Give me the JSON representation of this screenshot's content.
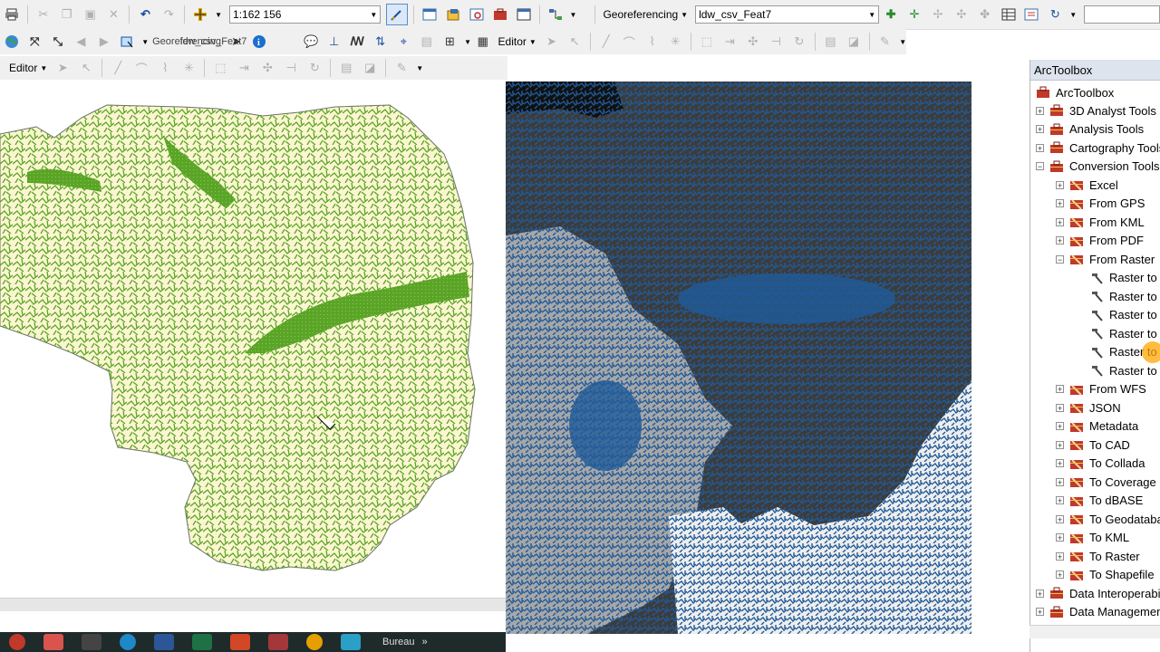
{
  "toolbar1": {
    "scale_value": "1:162 156",
    "georef_label": "Georeferencing",
    "layer_value": "ldw_csv_Feat7"
  },
  "toolbar2": {
    "editor_label": "Editor",
    "ghost_georef": "Georeferencing",
    "ghost_layer": "ldw_csv_Feat7"
  },
  "toolbar3": {
    "editor_label": "Editor"
  },
  "taskbar": {
    "text": "Bureau"
  },
  "toolbox": {
    "title": "ArcToolbox",
    "root": "ArcToolbox",
    "items": [
      {
        "label": "3D Analyst Tools",
        "level": 1,
        "expander": "+",
        "icon": "toolbox-icon"
      },
      {
        "label": "Analysis Tools",
        "level": 1,
        "expander": "+",
        "icon": "toolbox-icon"
      },
      {
        "label": "Cartography Tools",
        "level": 1,
        "expander": "+",
        "icon": "toolbox-icon"
      },
      {
        "label": "Conversion Tools",
        "level": 1,
        "expander": "−",
        "icon": "toolbox-icon"
      },
      {
        "label": "Excel",
        "level": 2,
        "expander": "+",
        "icon": "toolset-icon"
      },
      {
        "label": "From GPS",
        "level": 2,
        "expander": "+",
        "icon": "toolset-icon"
      },
      {
        "label": "From KML",
        "level": 2,
        "expander": "+",
        "icon": "toolset-icon"
      },
      {
        "label": "From PDF",
        "level": 2,
        "expander": "+",
        "icon": "toolset-icon"
      },
      {
        "label": "From Raster",
        "level": 2,
        "expander": "−",
        "icon": "toolset-icon"
      },
      {
        "label": "Raster to",
        "level": 3,
        "expander": "",
        "icon": "hammer-icon"
      },
      {
        "label": "Raster to",
        "level": 3,
        "expander": "",
        "icon": "hammer-icon"
      },
      {
        "label": "Raster to",
        "level": 3,
        "expander": "",
        "icon": "hammer-icon"
      },
      {
        "label": "Raster to",
        "level": 3,
        "expander": "",
        "icon": "hammer-icon"
      },
      {
        "label": "Raster to",
        "level": 3,
        "expander": "",
        "icon": "hammer-icon"
      },
      {
        "label": "Raster to",
        "level": 3,
        "expander": "",
        "icon": "hammer-icon"
      },
      {
        "label": "From WFS",
        "level": 2,
        "expander": "+",
        "icon": "toolset-icon"
      },
      {
        "label": "JSON",
        "level": 2,
        "expander": "+",
        "icon": "toolset-icon"
      },
      {
        "label": "Metadata",
        "level": 2,
        "expander": "+",
        "icon": "toolset-icon"
      },
      {
        "label": "To CAD",
        "level": 2,
        "expander": "+",
        "icon": "toolset-icon"
      },
      {
        "label": "To Collada",
        "level": 2,
        "expander": "+",
        "icon": "toolset-icon"
      },
      {
        "label": "To Coverage",
        "level": 2,
        "expander": "+",
        "icon": "toolset-icon"
      },
      {
        "label": "To dBASE",
        "level": 2,
        "expander": "+",
        "icon": "toolset-icon"
      },
      {
        "label": "To Geodatabase",
        "level": 2,
        "expander": "+",
        "icon": "toolset-icon"
      },
      {
        "label": "To KML",
        "level": 2,
        "expander": "+",
        "icon": "toolset-icon"
      },
      {
        "label": "To Raster",
        "level": 2,
        "expander": "+",
        "icon": "toolset-icon"
      },
      {
        "label": "To Shapefile",
        "level": 2,
        "expander": "+",
        "icon": "toolset-icon"
      },
      {
        "label": "Data Interoperability Tools",
        "level": 1,
        "expander": "+",
        "icon": "toolbox-icon"
      },
      {
        "label": "Data Management Tools",
        "level": 1,
        "expander": "+",
        "icon": "toolbox-icon"
      }
    ]
  },
  "colors": {
    "left_map_fill": "#fbf6d1",
    "left_map_streams": "#5aa526",
    "right_map_dark": "#3c3c3c",
    "right_map_blue": "#1f5a99",
    "right_map_light": "#d8d8d8",
    "toolbox_header": "#dde4ee"
  }
}
